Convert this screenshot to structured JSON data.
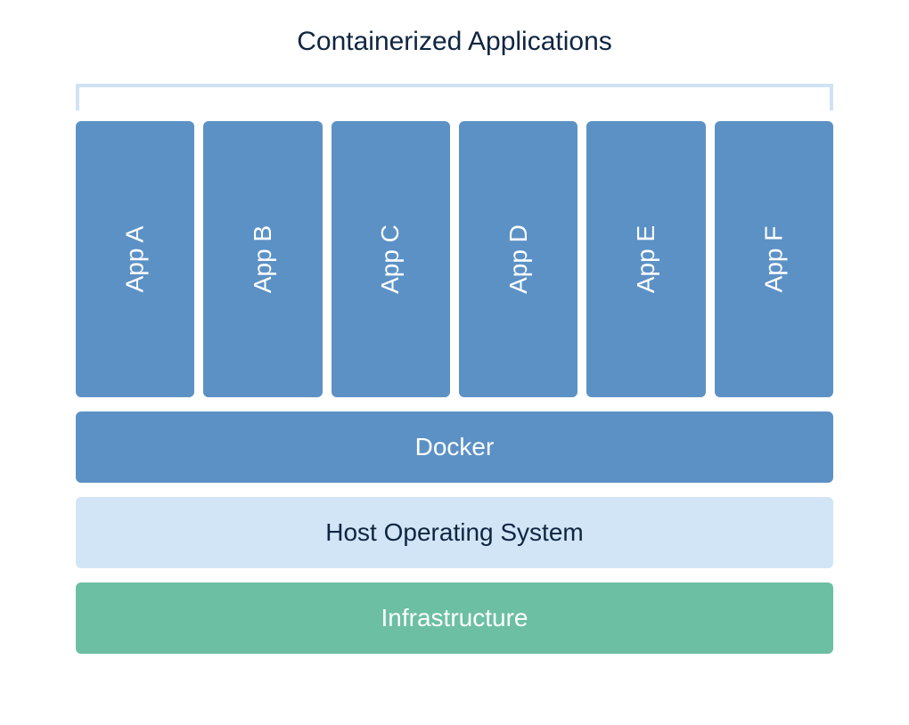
{
  "title": "Containerized Applications",
  "apps": {
    "a": "App A",
    "b": "App B",
    "c": "App C",
    "d": "App D",
    "e": "App E",
    "f": "App F"
  },
  "layers": {
    "docker": "Docker",
    "host": "Host Operating System",
    "infrastructure": "Infrastructure"
  },
  "colors": {
    "appBox": "#5c91c5",
    "hostLayer": "#d2e5f6",
    "infraLayer": "#6cbfa3",
    "bracket": "#cfe3f5",
    "titleText": "#0f2641"
  }
}
